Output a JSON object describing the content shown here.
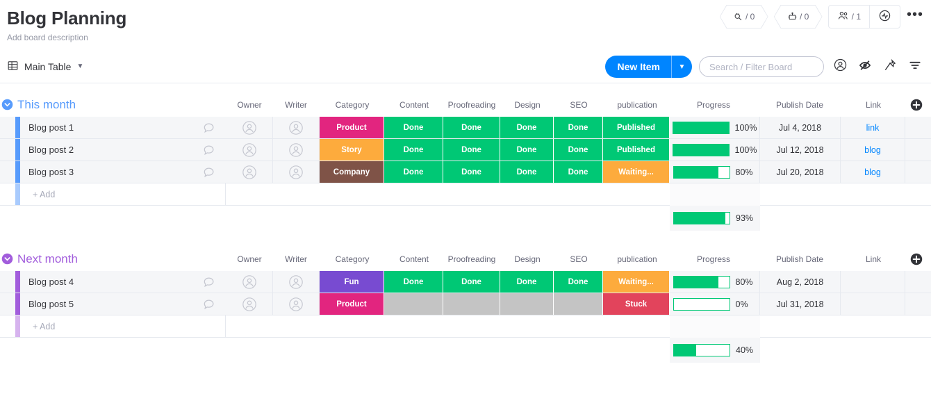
{
  "header": {
    "title": "Blog Planning",
    "description": "Add board description",
    "integrations": {
      "icon": "plug-integration-icon",
      "count": "/ 0"
    },
    "automations": {
      "icon": "robot-automation-icon",
      "count": "/ 0"
    },
    "members": {
      "icon": "people-icon",
      "count": "/ 1"
    },
    "activity": {
      "icon": "activity-pulse-icon"
    },
    "more": {
      "icon": "more-options-icon",
      "label": "•••"
    }
  },
  "toolbar": {
    "view_tab": {
      "icon": "table-icon",
      "label": "Main Table",
      "chevron": "chevron-down-icon"
    },
    "new_item": {
      "label": "New Item",
      "chevron": "chevron-down-icon"
    },
    "search": {
      "placeholder": "Search / Filter Board",
      "value": ""
    },
    "person_icon": "person-circle-icon",
    "hide_icon": "eye-slash-icon",
    "pin_icon": "pin-icon",
    "filter_icon": "filter-icon"
  },
  "columns": [
    {
      "key": "name",
      "label": ""
    },
    {
      "key": "chat",
      "label": ""
    },
    {
      "key": "owner",
      "label": "Owner"
    },
    {
      "key": "writer",
      "label": "Writer"
    },
    {
      "key": "category",
      "label": "Category"
    },
    {
      "key": "content",
      "label": "Content"
    },
    {
      "key": "proofreading",
      "label": "Proofreading"
    },
    {
      "key": "design",
      "label": "Design"
    },
    {
      "key": "seo",
      "label": "SEO"
    },
    {
      "key": "publication",
      "label": "publication"
    },
    {
      "key": "progress",
      "label": "Progress"
    },
    {
      "key": "publishdate",
      "label": "Publish Date"
    },
    {
      "key": "link",
      "label": "Link"
    }
  ],
  "add_column": {
    "icon": "add-column-icon",
    "label": "+"
  },
  "colors": {
    "accent_blue": "#0085ff",
    "group_blue": "#579bfc",
    "group_purple": "#a25ddc",
    "green": "#00c875",
    "orange": "#fdab3d",
    "pink": "#e2257f",
    "brown": "#7f5347",
    "purple": "#784bd1",
    "red": "#e2445c",
    "gray": "#c4c4c4"
  },
  "groups": [
    {
      "title": "This month",
      "color": "#579bfc",
      "accent": "#579bfc",
      "add_accent": "#a9cbfd",
      "caret": "collapse-group-icon",
      "add_label": "+ Add",
      "rows": [
        {
          "name": "Blog post 1",
          "chat": "chat-bubble-icon",
          "owner": "avatar-placeholder-icon",
          "writer": "avatar-placeholder-icon",
          "category": {
            "label": "Product",
            "color": "#e2257f"
          },
          "content": {
            "label": "Done",
            "color": "#00c875"
          },
          "proofreading": {
            "label": "Done",
            "color": "#00c875"
          },
          "design": {
            "label": "Done",
            "color": "#00c875"
          },
          "seo": {
            "label": "Done",
            "color": "#00c875"
          },
          "publication": {
            "label": "Published",
            "color": "#00c875"
          },
          "progress": {
            "percent": 100,
            "label": "100%"
          },
          "publishdate": "Jul 4, 2018",
          "link": "link"
        },
        {
          "name": "Blog post 2",
          "chat": "chat-bubble-icon",
          "owner": "avatar-placeholder-icon",
          "writer": "avatar-placeholder-icon",
          "category": {
            "label": "Story",
            "color": "#fdab3d"
          },
          "content": {
            "label": "Done",
            "color": "#00c875"
          },
          "proofreading": {
            "label": "Done",
            "color": "#00c875"
          },
          "design": {
            "label": "Done",
            "color": "#00c875"
          },
          "seo": {
            "label": "Done",
            "color": "#00c875"
          },
          "publication": {
            "label": "Published",
            "color": "#00c875"
          },
          "progress": {
            "percent": 100,
            "label": "100%"
          },
          "publishdate": "Jul 12, 2018",
          "link": "blog"
        },
        {
          "name": "Blog post 3",
          "chat": "chat-bubble-icon",
          "owner": "avatar-placeholder-icon",
          "writer": "avatar-placeholder-icon",
          "category": {
            "label": "Company",
            "color": "#7f5347"
          },
          "content": {
            "label": "Done",
            "color": "#00c875"
          },
          "proofreading": {
            "label": "Done",
            "color": "#00c875"
          },
          "design": {
            "label": "Done",
            "color": "#00c875"
          },
          "seo": {
            "label": "Done",
            "color": "#00c875"
          },
          "publication": {
            "label": "Waiting...",
            "color": "#fdab3d"
          },
          "progress": {
            "percent": 80,
            "label": "80%"
          },
          "publishdate": "Jul 20, 2018",
          "link": "blog"
        }
      ],
      "summary": {
        "percent": 93,
        "label": "93%"
      }
    },
    {
      "title": "Next month",
      "color": "#a25ddc",
      "accent": "#a25ddc",
      "add_accent": "#d6b3ee",
      "caret": "collapse-group-icon",
      "add_label": "+ Add",
      "rows": [
        {
          "name": "Blog post 4",
          "chat": "chat-bubble-icon",
          "owner": "avatar-placeholder-icon",
          "writer": "avatar-placeholder-icon",
          "category": {
            "label": "Fun",
            "color": "#784bd1"
          },
          "content": {
            "label": "Done",
            "color": "#00c875"
          },
          "proofreading": {
            "label": "Done",
            "color": "#00c875"
          },
          "design": {
            "label": "Done",
            "color": "#00c875"
          },
          "seo": {
            "label": "Done",
            "color": "#00c875"
          },
          "publication": {
            "label": "Waiting...",
            "color": "#fdab3d"
          },
          "progress": {
            "percent": 80,
            "label": "80%"
          },
          "publishdate": "Aug 2, 2018",
          "link": ""
        },
        {
          "name": "Blog post 5",
          "chat": "chat-bubble-icon",
          "owner": "avatar-placeholder-icon",
          "writer": "avatar-placeholder-icon",
          "category": {
            "label": "Product",
            "color": "#e2257f"
          },
          "content": {
            "label": "",
            "color": "#c4c4c4"
          },
          "proofreading": {
            "label": "",
            "color": "#c4c4c4"
          },
          "design": {
            "label": "",
            "color": "#c4c4c4"
          },
          "seo": {
            "label": "",
            "color": "#c4c4c4"
          },
          "publication": {
            "label": "Stuck",
            "color": "#e2445c"
          },
          "progress": {
            "percent": 0,
            "label": "0%"
          },
          "publishdate": "Jul 31, 2018",
          "link": ""
        }
      ],
      "summary": {
        "percent": 40,
        "label": "40%"
      }
    }
  ]
}
